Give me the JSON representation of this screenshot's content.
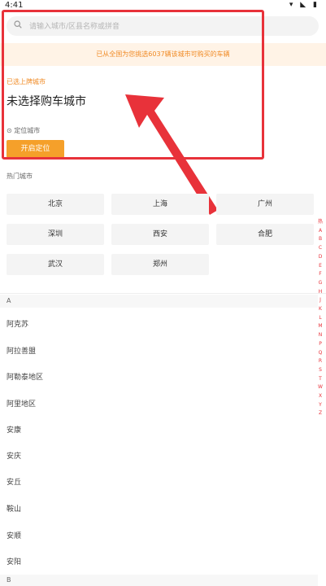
{
  "status": {
    "time": "4:41",
    "icons": "▾ ◣ ▮"
  },
  "search": {
    "placeholder": "请输入城市/区县名称或拼音"
  },
  "notice": {
    "text": "已从全国为您挑选6037辆该城市可购买的车辆"
  },
  "selected": {
    "label": "已选上牌城市",
    "city": "未选择购车城市"
  },
  "locate": {
    "label": "定位城市",
    "button_label": "开启定位"
  },
  "hot": {
    "title": "热门城市",
    "cities": [
      "北京",
      "上海",
      "广州",
      "深圳",
      "西安",
      "合肥",
      "武汉",
      "郑州"
    ]
  },
  "alphabet": [
    "热",
    "A",
    "B",
    "C",
    "D",
    "E",
    "F",
    "G",
    "H",
    "J",
    "K",
    "L",
    "M",
    "N",
    "P",
    "Q",
    "R",
    "S",
    "T",
    "W",
    "X",
    "Y",
    "Z"
  ],
  "list": {
    "section": "A",
    "items": [
      "阿克苏",
      "阿拉善盟",
      "阿勒泰地区",
      "阿里地区",
      "安康",
      "安庆",
      "安丘",
      "鞍山",
      "安顺",
      "安阳"
    ],
    "next_section": "B"
  },
  "colors": {
    "accent": "#f5a02a",
    "annotation": "#e8323a"
  }
}
